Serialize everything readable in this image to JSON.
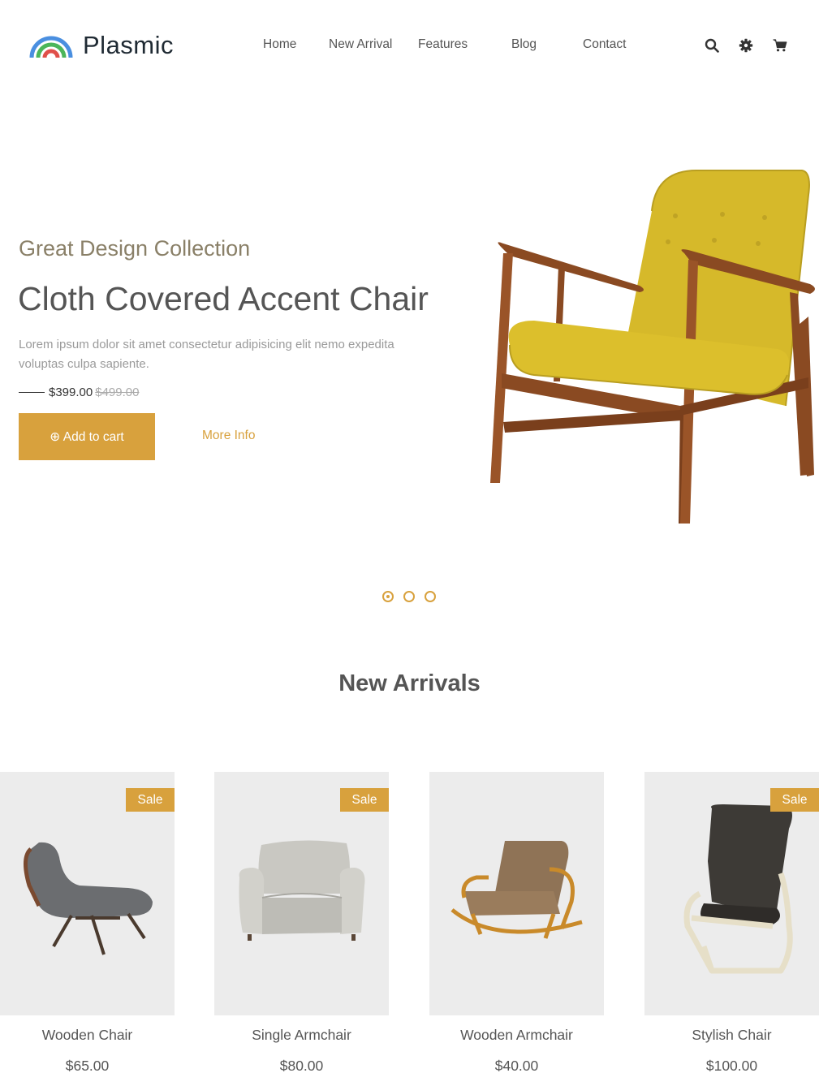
{
  "brand": {
    "name": "Plasmic"
  },
  "nav": {
    "items": [
      {
        "label": "Home",
        "name": "nav-home"
      },
      {
        "label": "New Arrival",
        "name": "nav-new-arrival"
      },
      {
        "label": "Features",
        "name": "nav-features"
      },
      {
        "label": "Blog",
        "name": "nav-blog"
      },
      {
        "label": "Contact",
        "name": "nav-contact"
      }
    ]
  },
  "header_icons": [
    "search-icon",
    "gear-icon",
    "cart-icon"
  ],
  "hero": {
    "subtitle": "Great Design Collection",
    "title": "Cloth Covered Accent Chair",
    "description": "Lorem ipsum dolor sit amet consectetur adipisicing elit nemo expedita voluptas culpa sapiente.",
    "price": "$399.00",
    "old_price": "$499.00",
    "add_to_cart": "⊕ Add to cart",
    "more_info": "More Info",
    "slides_count": 3,
    "active_slide": 1
  },
  "new_arrivals": {
    "title": "New Arrivals",
    "products": [
      {
        "name": "Wooden Chair",
        "price": "$65.00",
        "sale": true,
        "badge": "Sale"
      },
      {
        "name": "Single Armchair",
        "price": "$80.00",
        "sale": true,
        "badge": "Sale"
      },
      {
        "name": "Wooden Armchair",
        "price": "$40.00",
        "sale": false,
        "badge": ""
      },
      {
        "name": "Stylish Chair",
        "price": "$100.00",
        "sale": true,
        "badge": "Sale"
      }
    ]
  },
  "colors": {
    "accent": "#d8a13d",
    "text": "#555555",
    "card_bg": "#ececec",
    "subtitle": "#8a8068"
  }
}
